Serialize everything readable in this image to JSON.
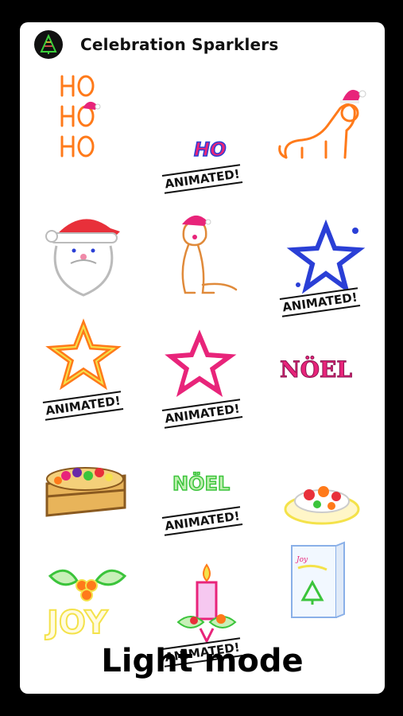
{
  "app": {
    "title": "Celebration Sparklers",
    "icon": "christmas-tree-icon"
  },
  "badge_label": "ANIMATED!",
  "mode_label": "Light mode",
  "stickers": [
    {
      "name": "ho-ho-ho-sticker",
      "text": "HO HO HO",
      "animated": false
    },
    {
      "name": "ho-sticker",
      "text": "HO",
      "animated": true
    },
    {
      "name": "santa-cat-sticker",
      "animated": false
    },
    {
      "name": "santa-face-sticker",
      "animated": false
    },
    {
      "name": "santa-dog-sticker",
      "animated": false
    },
    {
      "name": "blue-star-sticker",
      "animated": true
    },
    {
      "name": "orange-star-sticker",
      "animated": true
    },
    {
      "name": "pink-star-sticker",
      "animated": true
    },
    {
      "name": "noel-pink-sticker",
      "text": "NÖEL",
      "animated": false
    },
    {
      "name": "fruit-cake-sticker",
      "animated": false
    },
    {
      "name": "noel-green-sticker",
      "text": "NÖEL",
      "animated": true
    },
    {
      "name": "pasta-plate-sticker",
      "animated": false
    },
    {
      "name": "holly-joy-sticker",
      "text": "JOY",
      "animated": false
    },
    {
      "name": "candle-sticker",
      "animated": true
    },
    {
      "name": "greeting-card-sticker",
      "animated": false
    }
  ],
  "colors": {
    "orange": "#ff7a1a",
    "pink": "#e8247a",
    "blue": "#2a3fd6",
    "green": "#3bc43b",
    "yellow": "#f4e24a"
  }
}
